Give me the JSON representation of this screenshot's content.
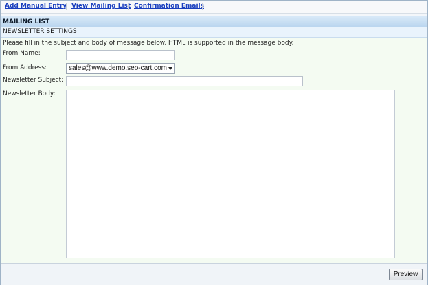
{
  "topnav": {
    "links": [
      "Add Manual Entry",
      "View Mailing List",
      "Confirmation Emails"
    ]
  },
  "header": {
    "title": "MAILING LIST",
    "subtitle": "NEWSLETTER SETTINGS"
  },
  "form": {
    "instructions": "Please fill in the subject and body of message below. HTML is supported in the message body.",
    "from_name_label": "From Name:",
    "from_name_value": "",
    "from_address_label": "From Address:",
    "from_address_value": "sales@www.demo.seo-cart.com",
    "subject_label": "Newsletter Subject:",
    "subject_value": "",
    "body_label": "Newsletter Body:",
    "body_value": ""
  },
  "footer": {
    "preview_label": "Preview"
  },
  "colors": {
    "link": "#1a3fbf",
    "header_gradient_top": "#d8e9f8",
    "header_gradient_bottom": "#b8d4ee",
    "form_background": "#f4fbf2"
  }
}
